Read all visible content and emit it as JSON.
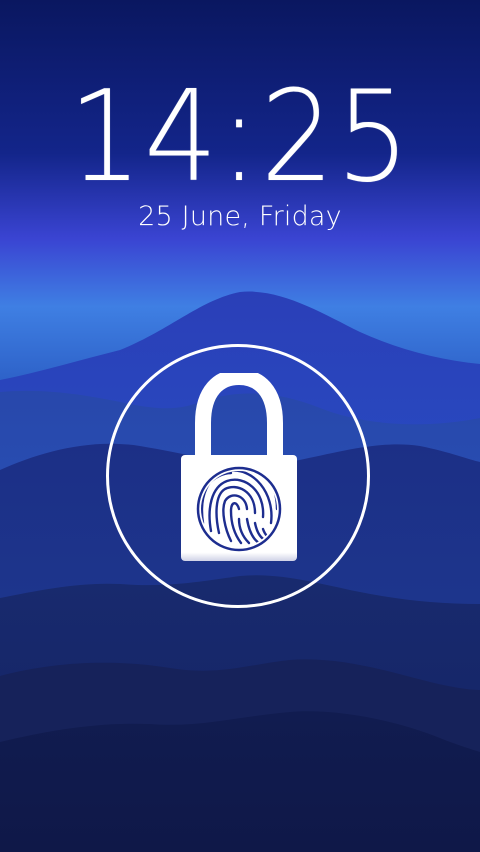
{
  "lockscreen": {
    "time": "14:25",
    "date": "25 June, Friday",
    "unlock_icon": "padlock-fingerprint-icon"
  },
  "colors": {
    "sky_top": "#0b1b6b",
    "sky_glow": "#3f4fd8",
    "mountain_light": "#2f5fd0",
    "mountain_dark": "#13205a",
    "foreground": "#ffffff",
    "fingerprint": "#1d2d8f"
  }
}
